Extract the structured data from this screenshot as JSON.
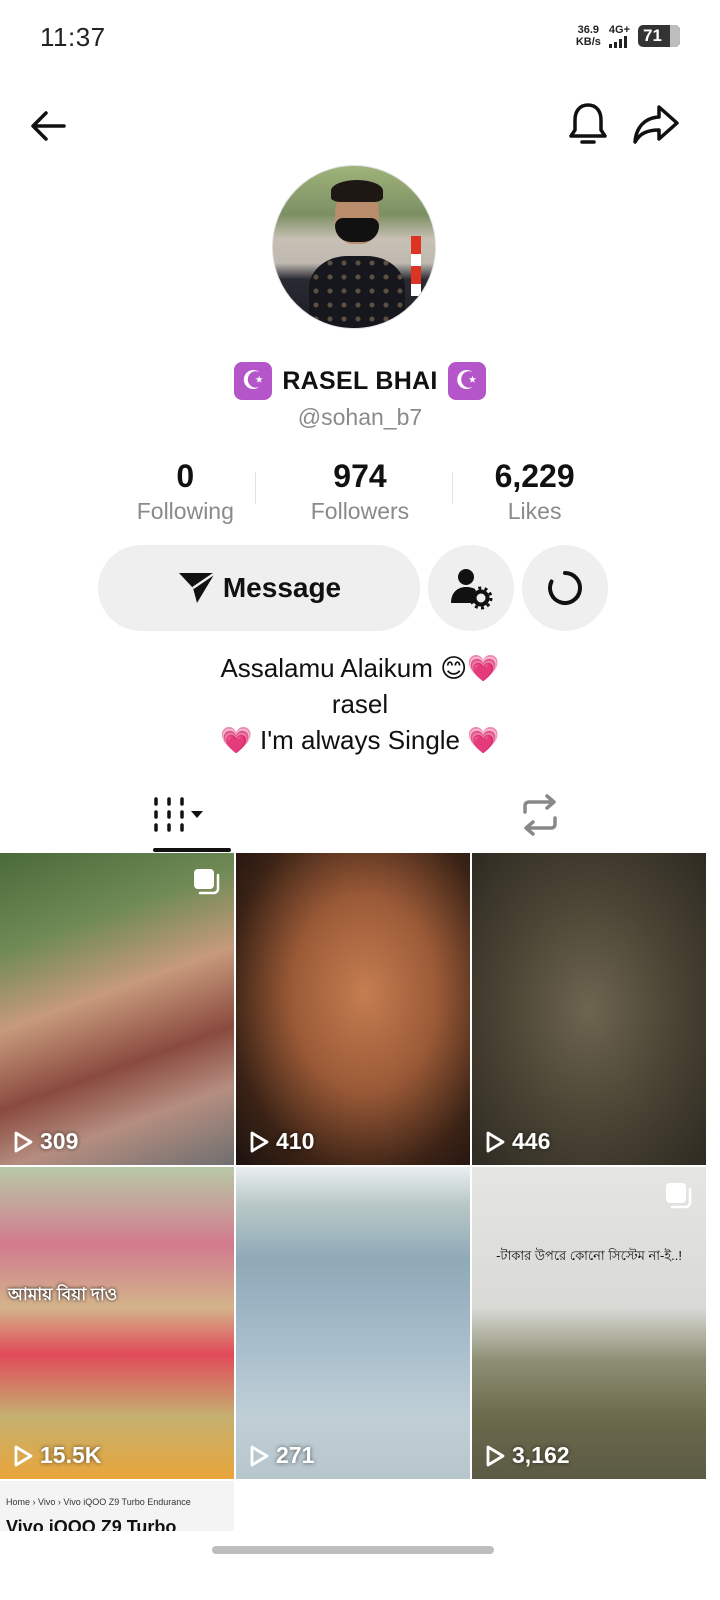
{
  "status_bar": {
    "time": "11:37",
    "net_speed_value": "36.9",
    "net_speed_unit": "KB/s",
    "network_type": "4G+",
    "battery": "71"
  },
  "profile": {
    "display_name": "RASEL BHAI",
    "name_emoji": "☪",
    "username": "@sohan_b7"
  },
  "stats": [
    {
      "value": "0",
      "label": "Following"
    },
    {
      "value": "974",
      "label": "Followers"
    },
    {
      "value": "6,229",
      "label": "Likes"
    }
  ],
  "actions": {
    "message_label": "Message"
  },
  "bio": {
    "line1": "Assalamu Alaikum 😊💗",
    "line2": "rasel",
    "line3": "💗 I'm always Single 💗"
  },
  "videos": [
    {
      "views": "309"
    },
    {
      "views": "410"
    },
    {
      "views": "446"
    },
    {
      "views": "15.5K",
      "overlay_text": "আমায় বিয়া দাও"
    },
    {
      "views": "271"
    },
    {
      "views": "3,162",
      "caption": "-টাকার উপরে কোনো সিস্টেম না-ই..!"
    },
    {
      "breadcrumb": "Home  ›  Vivo  ›  Vivo iQOO Z9 Turbo Endurance",
      "heading": "Vivo iQOO Z9 Turbo"
    }
  ],
  "colors": {
    "accent_text": "#111111",
    "muted_text": "#8a8a8a",
    "button_bg": "#efefef"
  }
}
